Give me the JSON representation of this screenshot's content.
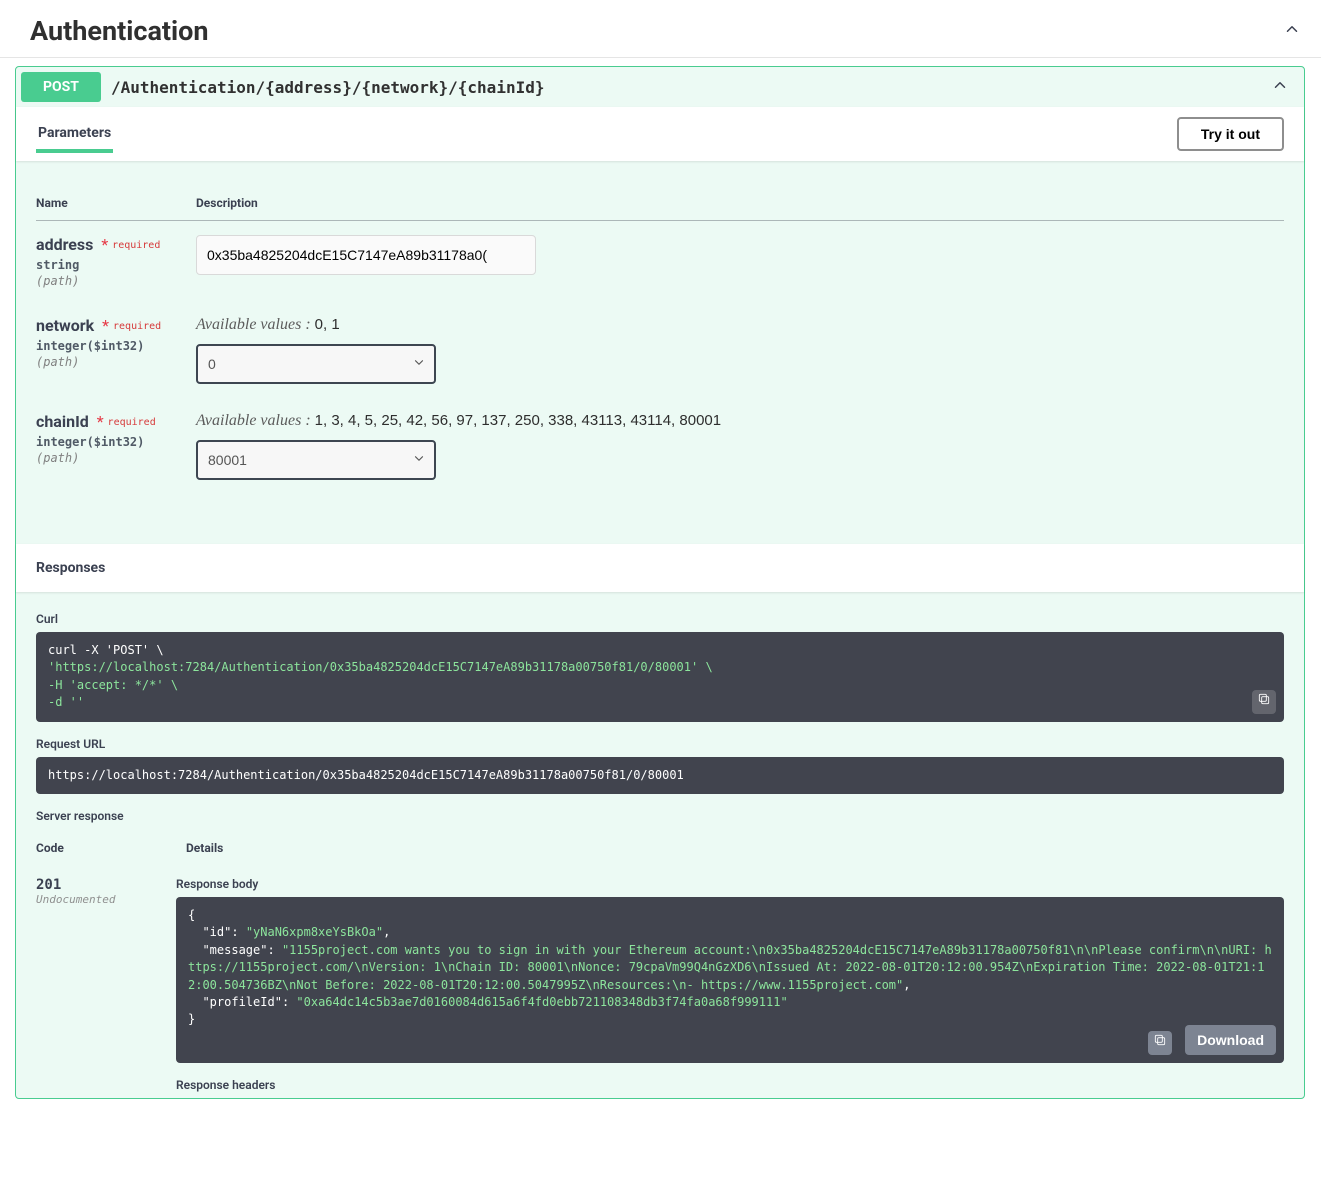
{
  "section": {
    "title": "Authentication"
  },
  "operation": {
    "method": "POST",
    "path": "/Authentication/{address}/{network}/{chainId}"
  },
  "tabs": {
    "parameters": "Parameters"
  },
  "buttons": {
    "tryItOut": "Try it out",
    "download": "Download"
  },
  "paramsTable": {
    "headers": {
      "name": "Name",
      "description": "Description"
    },
    "requiredLabel": "required"
  },
  "availableValuesLabel": "Available values",
  "params": {
    "address": {
      "name": "address",
      "type": "string",
      "inPath": "(path)",
      "value": "0x35ba4825204dcE15C7147eA89b31178a0("
    },
    "network": {
      "name": "network",
      "type": "integer($int32)",
      "inPath": "(path)",
      "availableValues": "0, 1",
      "selected": "0"
    },
    "chainId": {
      "name": "chainId",
      "type": "integer($int32)",
      "inPath": "(path)",
      "availableValues": "1, 3, 4, 5, 25, 42, 56, 97, 137, 250, 338, 43113, 43114, 80001",
      "selected": "80001"
    }
  },
  "responsesHeader": "Responses",
  "curl": {
    "label": "Curl",
    "line1": "curl -X 'POST' \\",
    "line2": "  'https://localhost:7284/Authentication/0x35ba4825204dcE15C7147eA89b31178a00750f81/0/80001' \\",
    "line3": "  -H 'accept: */*' \\",
    "line4": "  -d ''"
  },
  "requestUrl": {
    "label": "Request URL",
    "value": "https://localhost:7284/Authentication/0x35ba4825204dcE15C7147eA89b31178a00750f81/0/80001"
  },
  "serverResponse": {
    "label": "Server response",
    "codeHeader": "Code",
    "detailsHeader": "Details"
  },
  "response": {
    "code": "201",
    "undocumented": "Undocumented",
    "bodyLabel": "Response body",
    "headersLabel": "Response headers",
    "body": {
      "open": "{",
      "idKey": "\"id\"",
      "idVal": "\"yNaN6xpm8xeYsBkOa\"",
      "messageKey": "\"message\"",
      "messageVal": "\"1155project.com wants you to sign in with your Ethereum account:\\n0x35ba4825204dcE15C7147eA89b31178a00750f81\\n\\nPlease confirm\\n\\nURI: https://1155project.com/\\nVersion: 1\\nChain ID: 80001\\nNonce: 79cpaVm99Q4nGzXD6\\nIssued At: 2022-08-01T20:12:00.954Z\\nExpiration Time: 2022-08-01T21:12:00.504736BZ\\nNot Before: 2022-08-01T20:12:00.5047995Z\\nResources:\\n- https://www.1155project.com\"",
      "profileKey": "\"profileId\"",
      "profileVal": "\"0xa64dc14c5b3ae7d0160084d615a6f4fd0ebb721108348db3f74fa0a68f999111\"",
      "close": "}"
    }
  }
}
